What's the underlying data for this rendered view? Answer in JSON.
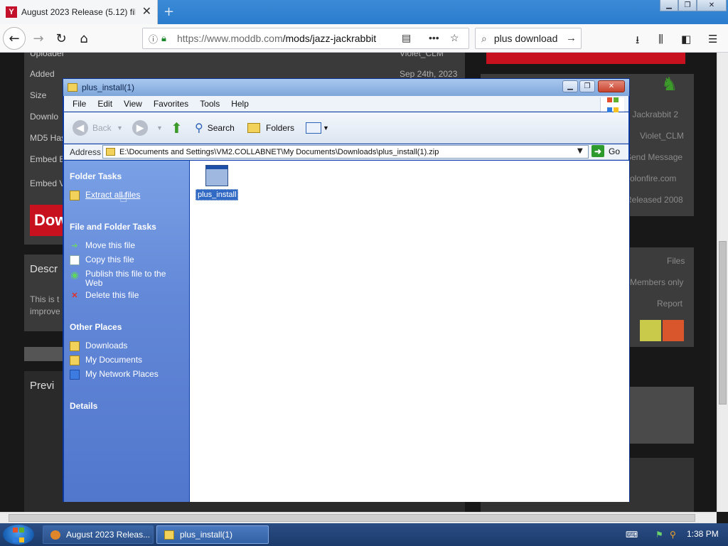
{
  "browser": {
    "tab_title": "August 2023 Release (5.12) file -",
    "tab_favicon_letter": "Y",
    "url_domain": "https://www.moddb.com",
    "url_path": "/mods/jazz-jackrabbit",
    "search_text": "plus download",
    "colors": {
      "tabbar": "#2b7ccd",
      "favicon": "#c3112b"
    }
  },
  "webpage": {
    "rows": [
      {
        "label": "Uploader",
        "value": "Violet_CLM"
      },
      {
        "label": "Added",
        "value": "Sep 24th, 2023"
      },
      {
        "label": "Size",
        "value": ""
      },
      {
        "label": "Downlo",
        "value": ""
      },
      {
        "label": "MD5 Has",
        "value": ""
      },
      {
        "label": "Embed B",
        "value": ""
      },
      {
        "label": "Embed V",
        "value": ""
      }
    ],
    "download_button": "Dow",
    "section_desc": "Descr",
    "desc_line1": "This is t",
    "desc_line2": "improve",
    "section_preview": "Previ",
    "right_items": [
      "z Jackrabbit 2",
      "Violet_CLM",
      "Send Message",
      "colonfire.com",
      "Released 2008",
      "Files",
      "Members only",
      "Report"
    ]
  },
  "explorer": {
    "title": "plus_install(1)",
    "menu": [
      "File",
      "Edit",
      "View",
      "Favorites",
      "Tools",
      "Help"
    ],
    "toolbar": {
      "back": "Back",
      "search": "Search",
      "folders": "Folders"
    },
    "address_label": "Address",
    "address_value": "E:\\Documents and Settings\\VM2.COLLABNET\\My Documents\\Downloads\\plus_install(1).zip",
    "go_label": "Go",
    "folder_tasks": {
      "heading": "Folder Tasks",
      "items": [
        "Extract all files"
      ]
    },
    "file_tasks": {
      "heading": "File and Folder Tasks",
      "items": [
        "Move this file",
        "Copy this file",
        "Publish this file to the Web",
        "Delete this file"
      ]
    },
    "other_places": {
      "heading": "Other Places",
      "items": [
        "Downloads",
        "My Documents",
        "My Network Places"
      ]
    },
    "details_heading": "Details",
    "file_item": {
      "name": "plus_install",
      "icon": "application-window-icon"
    }
  },
  "taskbar": {
    "buttons": [
      "August 2023 Releas...",
      "plus_install(1)"
    ],
    "clock": "1:38 PM"
  }
}
